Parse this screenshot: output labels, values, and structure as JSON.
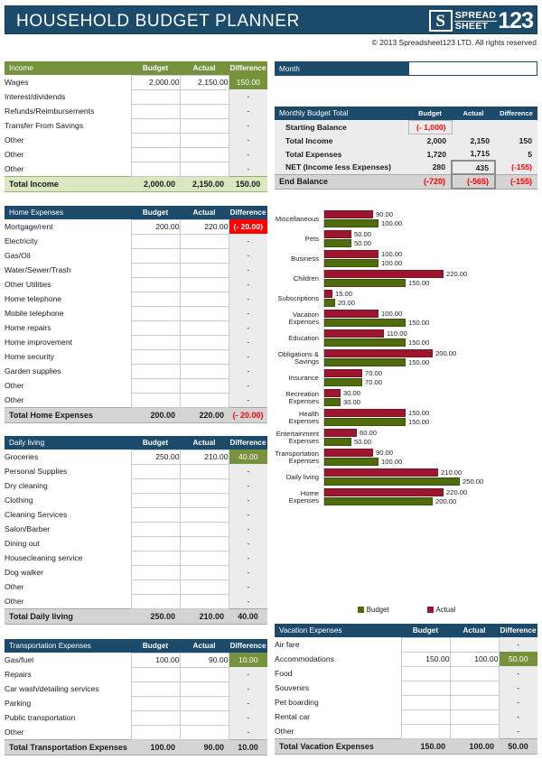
{
  "header": {
    "title": "HOUSEHOLD BUDGET PLANNER",
    "logo_letter": "S",
    "logo_word_top": "SPREAD",
    "logo_word_bottom": "SHEET",
    "logo_number": "123",
    "copyright": "© 2013 Spreadsheet123 LTD. All rights reserved"
  },
  "month": {
    "label": "Month",
    "value": ""
  },
  "columns": {
    "budget": "Budget",
    "actual": "Actual",
    "difference": "Difference"
  },
  "income": {
    "title": "Income",
    "rows": [
      {
        "name": "Wages",
        "budget": "2,000.00",
        "actual": "2,150.00",
        "difference": "150.00",
        "diff_style": "hl-green"
      },
      {
        "name": "Interest/dividends",
        "budget": "",
        "actual": "",
        "difference": "-",
        "diff_style": ""
      },
      {
        "name": "Refunds/Reimbursements",
        "budget": "",
        "actual": "",
        "difference": "-",
        "diff_style": ""
      },
      {
        "name": "Transfer From Savings",
        "budget": "",
        "actual": "",
        "difference": "-",
        "diff_style": ""
      },
      {
        "name": "Other",
        "budget": "",
        "actual": "",
        "difference": "-",
        "diff_style": ""
      },
      {
        "name": "Other",
        "budget": "",
        "actual": "",
        "difference": "-",
        "diff_style": ""
      },
      {
        "name": "Other",
        "budget": "",
        "actual": "",
        "difference": "-",
        "diff_style": ""
      }
    ],
    "total": {
      "name": "Total Income",
      "budget": "2,000.00",
      "actual": "2,150.00",
      "difference": "150.00"
    }
  },
  "home_expenses": {
    "title": "Home Expenses",
    "rows": [
      {
        "name": "Mortgage/rent",
        "budget": "200.00",
        "actual": "220.00",
        "difference": "(- 20.00)",
        "diff_style": "hl-red"
      },
      {
        "name": "Electricity",
        "budget": "",
        "actual": "",
        "difference": "-",
        "diff_style": ""
      },
      {
        "name": "Gas/Oil",
        "budget": "",
        "actual": "",
        "difference": "-",
        "diff_style": ""
      },
      {
        "name": "Water/Sewer/Trash",
        "budget": "",
        "actual": "",
        "difference": "-",
        "diff_style": ""
      },
      {
        "name": "Other Utilities",
        "budget": "",
        "actual": "",
        "difference": "-",
        "diff_style": ""
      },
      {
        "name": "Home telephone",
        "budget": "",
        "actual": "",
        "difference": "-",
        "diff_style": ""
      },
      {
        "name": "Mobile telephone",
        "budget": "",
        "actual": "",
        "difference": "-",
        "diff_style": ""
      },
      {
        "name": "Home repairs",
        "budget": "",
        "actual": "",
        "difference": "-",
        "diff_style": ""
      },
      {
        "name": "Home improvement",
        "budget": "",
        "actual": "",
        "difference": "-",
        "diff_style": ""
      },
      {
        "name": "Home security",
        "budget": "",
        "actual": "",
        "difference": "-",
        "diff_style": ""
      },
      {
        "name": "Garden supplies",
        "budget": "",
        "actual": "",
        "difference": "-",
        "diff_style": ""
      },
      {
        "name": "Other",
        "budget": "",
        "actual": "",
        "difference": "-",
        "diff_style": ""
      },
      {
        "name": "Other",
        "budget": "",
        "actual": "",
        "difference": "-",
        "diff_style": ""
      }
    ],
    "total": {
      "name": "Total Home Expenses",
      "budget": "200.00",
      "actual": "220.00",
      "difference": "(- 20.00)",
      "diff_neg": true
    }
  },
  "daily_living": {
    "title": "Daily living",
    "rows": [
      {
        "name": "Groceries",
        "budget": "250.00",
        "actual": "210.00",
        "difference": "40.00",
        "diff_style": "hl-green"
      },
      {
        "name": "Personal Supplies",
        "budget": "",
        "actual": "",
        "difference": "-",
        "diff_style": ""
      },
      {
        "name": "Dry cleaning",
        "budget": "",
        "actual": "",
        "difference": "-",
        "diff_style": ""
      },
      {
        "name": "Clothing",
        "budget": "",
        "actual": "",
        "difference": "-",
        "diff_style": ""
      },
      {
        "name": "Cleaning Services",
        "budget": "",
        "actual": "",
        "difference": "-",
        "diff_style": ""
      },
      {
        "name": "Salon/Barber",
        "budget": "",
        "actual": "",
        "difference": "-",
        "diff_style": ""
      },
      {
        "name": "Dining out",
        "budget": "",
        "actual": "",
        "difference": "-",
        "diff_style": ""
      },
      {
        "name": "Housecleaning service",
        "budget": "",
        "actual": "",
        "difference": "-",
        "diff_style": ""
      },
      {
        "name": "Dog walker",
        "budget": "",
        "actual": "",
        "difference": "-",
        "diff_style": ""
      },
      {
        "name": "Other",
        "budget": "",
        "actual": "",
        "difference": "-",
        "diff_style": ""
      },
      {
        "name": "Other",
        "budget": "",
        "actual": "",
        "difference": "-",
        "diff_style": ""
      }
    ],
    "total": {
      "name": "Total Daily living",
      "budget": "250.00",
      "actual": "210.00",
      "difference": "40.00"
    }
  },
  "transportation": {
    "title": "Transportation Expenses",
    "rows": [
      {
        "name": "Gas/fuel",
        "budget": "100.00",
        "actual": "90.00",
        "difference": "10.00",
        "diff_style": "hl-green"
      },
      {
        "name": "Repairs",
        "budget": "",
        "actual": "",
        "difference": "-",
        "diff_style": ""
      },
      {
        "name": "Car wash/detailing services",
        "budget": "",
        "actual": "",
        "difference": "-",
        "diff_style": ""
      },
      {
        "name": "Parking",
        "budget": "",
        "actual": "",
        "difference": "-",
        "diff_style": ""
      },
      {
        "name": "Public transportation",
        "budget": "",
        "actual": "",
        "difference": "-",
        "diff_style": ""
      },
      {
        "name": "Other",
        "budget": "",
        "actual": "",
        "difference": "-",
        "diff_style": ""
      }
    ],
    "total": {
      "name": "Total Transportation Expenses",
      "budget": "100.00",
      "actual": "90.00",
      "difference": "10.00"
    }
  },
  "vacation": {
    "title": "Vacation Expenses",
    "rows": [
      {
        "name": "Air fare",
        "budget": "",
        "actual": "",
        "difference": "-",
        "diff_style": ""
      },
      {
        "name": "Accommodations",
        "budget": "150.00",
        "actual": "100.00",
        "difference": "50.00",
        "diff_style": "hl-green"
      },
      {
        "name": "Food",
        "budget": "",
        "actual": "",
        "difference": "-",
        "diff_style": ""
      },
      {
        "name": "Souvenirs",
        "budget": "",
        "actual": "",
        "difference": "-",
        "diff_style": ""
      },
      {
        "name": "Pet boarding",
        "budget": "",
        "actual": "",
        "difference": "-",
        "diff_style": ""
      },
      {
        "name": "Rental car",
        "budget": "",
        "actual": "",
        "difference": "-",
        "diff_style": ""
      },
      {
        "name": "Other",
        "budget": "",
        "actual": "",
        "difference": "-",
        "diff_style": ""
      }
    ],
    "total": {
      "name": "Total Vacation Expenses",
      "budget": "150.00",
      "actual": "100.00",
      "difference": "50.00"
    }
  },
  "monthly_budget_total": {
    "title": "Monthly Budget Total",
    "rows": [
      {
        "name": "Starting Balance",
        "budget": "(- 1,000)",
        "budget_neg": true,
        "budget_boxed": true,
        "actual": "",
        "difference": ""
      },
      {
        "name": "Total Income",
        "budget": "2,000",
        "actual": "2,150",
        "difference": "150"
      },
      {
        "name": "Total Expenses",
        "budget": "1,720",
        "actual": "1,715",
        "difference": "5"
      },
      {
        "name": "NET (Income less Expenses)",
        "budget": "280",
        "actual": "435",
        "actual_boxed": true,
        "difference": "(-155)",
        "diff_neg": true
      }
    ],
    "end_balance": {
      "name": "End Balance",
      "budget": "(-720)",
      "actual": "(-565)",
      "difference": "(-155)"
    }
  },
  "chart_data": {
    "type": "bar",
    "orientation": "horizontal",
    "title": "",
    "xlabel": "",
    "ylabel": "",
    "grid": false,
    "legend_position": "bottom",
    "xlim": [
      0,
      250
    ],
    "categories": [
      "Miscellaneous",
      "Pets",
      "Business",
      "Children",
      "Subscriptions",
      "Vacation Expenses",
      "Education",
      "Obligations & Savings",
      "Insurance",
      "Recreation Expenses",
      "Health Expenses",
      "Entertainment Expenses",
      "Transportation Expenses",
      "Daily living",
      "Home Expenses"
    ],
    "series": [
      {
        "name": "Actual",
        "color": "#9c1630",
        "values": [
          90.0,
          50.0,
          100.0,
          220.0,
          15.0,
          100.0,
          110.0,
          200.0,
          70.0,
          30.0,
          150.0,
          60.0,
          90.0,
          210.0,
          220.0
        ]
      },
      {
        "name": "Budget",
        "color": "#4f6b0d",
        "values": [
          100.0,
          50.0,
          100.0,
          150.0,
          20.0,
          150.0,
          150.0,
          150.0,
          70.0,
          30.0,
          150.0,
          50.0,
          100.0,
          250.0,
          200.0
        ]
      }
    ],
    "labels": {
      "actual": [
        "90.00",
        "50.00",
        "100.00",
        "220.00",
        "15.00",
        "100.00",
        "110.00",
        "200.00",
        "70.00",
        "30.00",
        "150.00",
        "60.00",
        "90.00",
        "210.00",
        "220.00"
      ],
      "budget": [
        "100.00",
        "50.00",
        "100.00",
        "150.00",
        "20.00",
        "150.00",
        "150.00",
        "150.00",
        "70.00",
        "30.00",
        "150.00",
        "50.00",
        "100.00",
        "250.00",
        "200.00"
      ]
    }
  }
}
